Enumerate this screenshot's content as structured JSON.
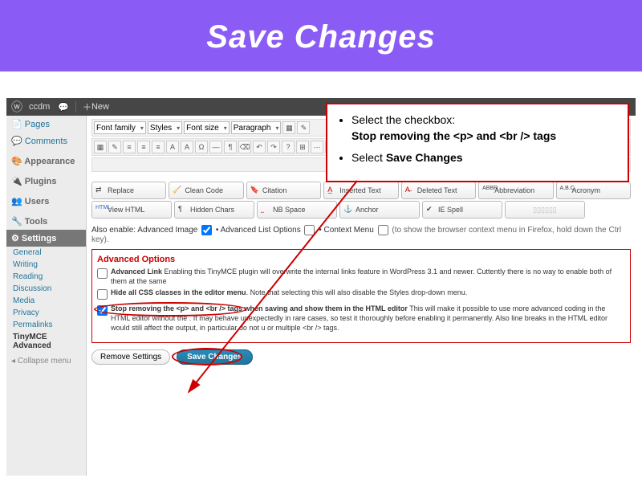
{
  "banner": {
    "title": "Save Changes"
  },
  "callout": {
    "line1_prefix": "Select the checkbox:",
    "line1_bold": "Stop removing the <p> and <br /> tags",
    "line2_prefix": "Select ",
    "line2_bold": "Save Changes"
  },
  "adminbar": {
    "site": "ccdm",
    "new": "New"
  },
  "sidebar": {
    "pages": "Pages",
    "comments": "Comments",
    "appearance": "Appearance",
    "plugins": "Plugins",
    "users": "Users",
    "tools": "Tools",
    "settings": "Settings",
    "subs": {
      "general": "General",
      "writing": "Writing",
      "reading": "Reading",
      "discussion": "Discussion",
      "media": "Media",
      "privacy": "Privacy",
      "permalinks": "Permalinks",
      "tinymce": "TinyMCE Advanced"
    },
    "collapse": "Collapse menu"
  },
  "toolbar": {
    "font_family": "Font family",
    "styles": "Styles",
    "font_size": "Font size",
    "paragraph": "Paragraph"
  },
  "buttons": {
    "replace": "Replace",
    "clean": "Clean Code",
    "citation": "Citation",
    "inserted": "Inserted Text",
    "deleted": "Deleted Text",
    "abbr": "Abbreviation",
    "acronym": "Acronym",
    "viewhtml": "View HTML",
    "hidden": "Hidden Chars",
    "nbspace": "NB Space",
    "anchor": "Anchor",
    "iespell": "IE Spell"
  },
  "also": {
    "label": "Also enable:",
    "adv_image": "Advanced Image",
    "adv_list": "Advanced List Options",
    "context": "Context Menu",
    "note": "(to show the browser context menu in Firefox, hold down the Ctrl key)."
  },
  "adv": {
    "heading": "Advanced Options",
    "link_label": "Advanced Link",
    "link_text": "Enabling this TinyMCE plugin will overwrite the internal links feature in WordPress 3.1 and newer. Cuttently there is no way to enable both of them at the same",
    "hide_label": "Hide all CSS classes in the editor menu",
    "hide_text": ". Note that selecting this will also disable the Styles drop-down menu.",
    "stop_label": "Stop removing the <p> and <br /> tags when saving and show them in the HTML editor",
    "stop_text": "This will make it possible to use more advanced coding in the HTML editor without the . It may behave unexpectedly in rare cases, so test it thoroughly before enabling it permanently. Also line breaks in the HTML editor would still affect the output, in particular do not u or multiple <br /> tags."
  },
  "bottom": {
    "remove": "Remove Settings",
    "save": "Save Changes"
  }
}
